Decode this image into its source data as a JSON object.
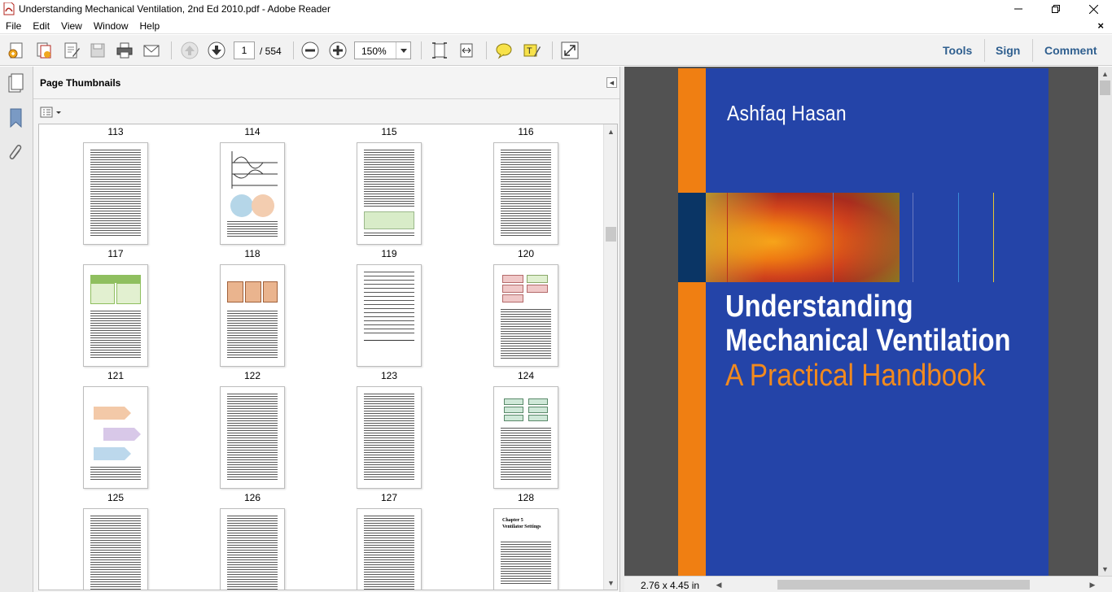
{
  "window": {
    "title": "Understanding Mechanical Ventilation, 2nd Ed 2010.pdf - Adobe Reader",
    "minimize_glyph": "—",
    "maximize_glyph": "❐",
    "close_glyph": "✕"
  },
  "menu": {
    "items": [
      "File",
      "Edit",
      "View",
      "Window",
      "Help"
    ],
    "close_glyph": "×"
  },
  "toolbar": {
    "current_page": "1",
    "total_pages": "/ 554",
    "zoom": "150%",
    "links": [
      "Tools",
      "Sign",
      "Comment"
    ],
    "icons": [
      "create-pdf-icon",
      "combine-files-icon",
      "edit-icon",
      "save-icon",
      "print-icon",
      "email-icon",
      "previous-page-icon",
      "next-page-icon",
      "zoom-out-icon",
      "zoom-in-icon",
      "fit-page-icon",
      "fit-width-icon",
      "sticky-note-icon",
      "highlight-icon",
      "full-screen-icon"
    ]
  },
  "left_rail": {
    "icons": [
      "page-thumbnails-icon",
      "bookmarks-icon",
      "attachments-icon"
    ]
  },
  "thumbnails_panel": {
    "title": "Page Thumbnails",
    "rows": [
      {
        "labels_above": [
          "113",
          "114",
          "115",
          "116"
        ],
        "labels_below": [
          "117",
          "118",
          "119",
          "120"
        ]
      },
      {
        "labels_below": [
          "121",
          "122",
          "123",
          "124"
        ]
      },
      {
        "labels_below": [
          "125",
          "126",
          "127",
          "128"
        ]
      }
    ],
    "last_row_chapter_text": [
      "Chapter 5",
      "Ventilator Settings"
    ]
  },
  "document": {
    "author": "Ashfaq Hasan",
    "title_line1": "Understanding",
    "title_line2": "Mechanical Ventilation",
    "subtitle": "A Practical Handbook",
    "page_size": "2.76 x 4.45 in",
    "colors": {
      "cover_blue": "#2444a8",
      "cover_orange": "#f07f12",
      "cover_navy": "#0a3565",
      "subtitle_orange": "#f28a1e"
    }
  }
}
